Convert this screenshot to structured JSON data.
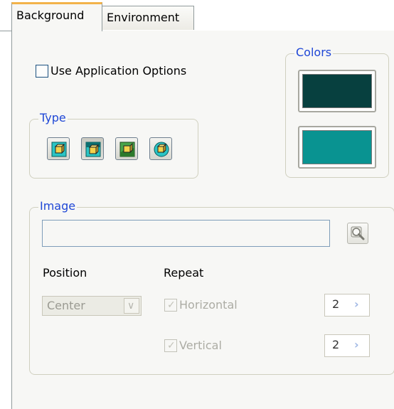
{
  "tabs": [
    {
      "label": "Background",
      "active": true
    },
    {
      "label": "Environment",
      "active": false
    }
  ],
  "use_app_options": {
    "label": "Use Application Options",
    "checked": false
  },
  "type_group": {
    "legend": "Type",
    "buttons": [
      {
        "icon": "cube-single-icon",
        "pressed": false
      },
      {
        "icon": "cube-gradient-icon",
        "pressed": true
      },
      {
        "icon": "cube-image-icon",
        "pressed": false
      },
      {
        "icon": "sphere-env-icon",
        "pressed": false
      }
    ]
  },
  "colors_group": {
    "legend": "Colors",
    "top_color": "#07403f",
    "bottom_color": "#099391"
  },
  "image_group": {
    "legend": "Image",
    "path_value": "",
    "position_label": "Position",
    "position_value": "Center",
    "repeat_label": "Repeat",
    "horizontal": {
      "label": "Horizontal",
      "checked": true,
      "value": "2"
    },
    "vertical": {
      "label": "Vertical",
      "checked": true,
      "value": "2"
    }
  }
}
